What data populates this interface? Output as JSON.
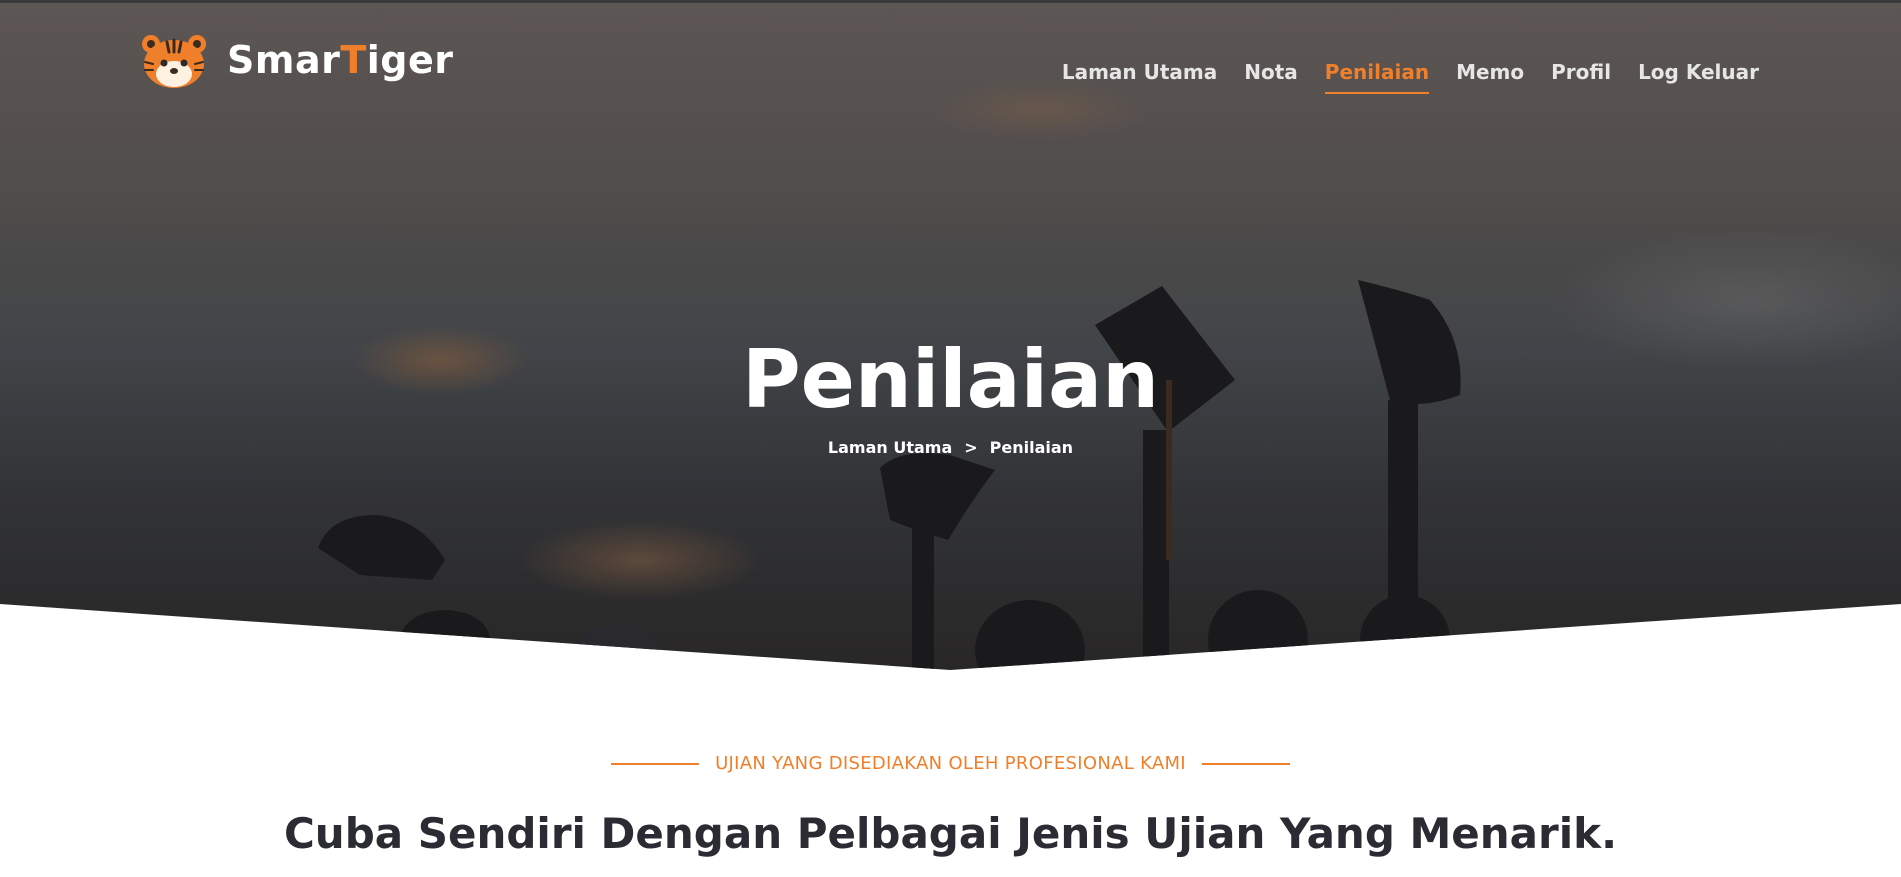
{
  "brand": {
    "name_prefix": "Smar",
    "name_accent": "T",
    "name_suffix": "iger",
    "icon": "tiger-face-icon",
    "accent_color": "#f07f2b"
  },
  "nav": {
    "items": [
      {
        "label": "Laman Utama",
        "active": false
      },
      {
        "label": "Nota",
        "active": false
      },
      {
        "label": "Penilaian",
        "active": true
      },
      {
        "label": "Memo",
        "active": false
      },
      {
        "label": "Profil",
        "active": false
      },
      {
        "label": "Log Keluar",
        "active": false
      }
    ]
  },
  "hero": {
    "title": "Penilaian",
    "breadcrumb": {
      "home": "Laman Utama",
      "separator": ">",
      "current": "Penilaian"
    }
  },
  "section": {
    "subtitle": "UJIAN YANG DISEDIAKAN OLEH PROFESIONAL KAMI",
    "heading": "Cuba Sendiri Dengan Pelbagai Jenis Ujian Yang Menarik."
  }
}
